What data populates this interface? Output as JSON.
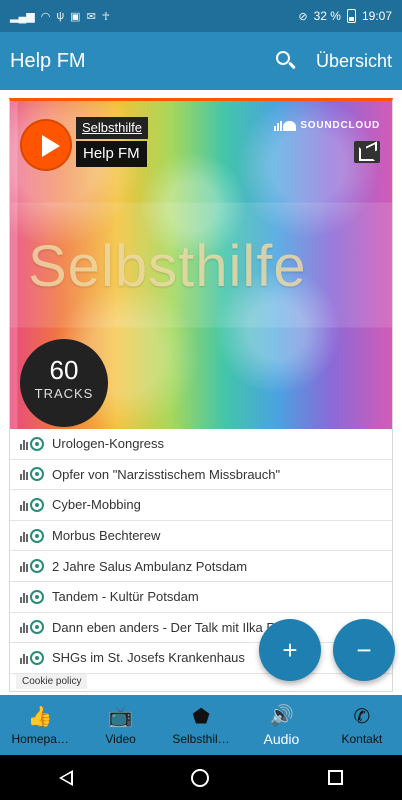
{
  "status_bar": {
    "battery": "32 %",
    "time": "19:07"
  },
  "app_bar": {
    "title": "Help FM",
    "overview_label": "Übersicht"
  },
  "player": {
    "user_link": "Selbsthilfe",
    "title": "Help FM",
    "soundcloud_label": "SOUNDCLOUD",
    "artwork_text": "Selbsthilfe",
    "tracks_count": "60",
    "tracks_label": "TRACKS",
    "accent_color": "#ff5500"
  },
  "tracks": [
    "Urologen-Kongress",
    "Opfer von \"Narzisstischem Missbrauch\"",
    "Cyber-Mobbing",
    "Morbus Bechterew",
    "2 Jahre Salus Ambulanz Potsdam",
    "Tandem - Kultür Potsdam",
    "Dann eben anders - Der Talk mit Ilka R",
    "SHGs im St. Josefs Krankenhaus"
  ],
  "cookie_policy": "Cookie policy",
  "fab": {
    "plus": "+",
    "minus": "−"
  },
  "bottom_nav": [
    {
      "label": "Homepa…",
      "icon": "thumbs-up-icon"
    },
    {
      "label": "Video",
      "icon": "tv-icon"
    },
    {
      "label": "Selbsthil…",
      "icon": "brandenburg-map-icon"
    },
    {
      "label": "Audio",
      "icon": "speaker-icon",
      "active": true
    },
    {
      "label": "Kontakt",
      "icon": "phone-icon"
    }
  ],
  "colors": {
    "app_bar": "#2b8bbd",
    "status_bar": "#1f6f9a",
    "fab": "#1f7fb0"
  }
}
